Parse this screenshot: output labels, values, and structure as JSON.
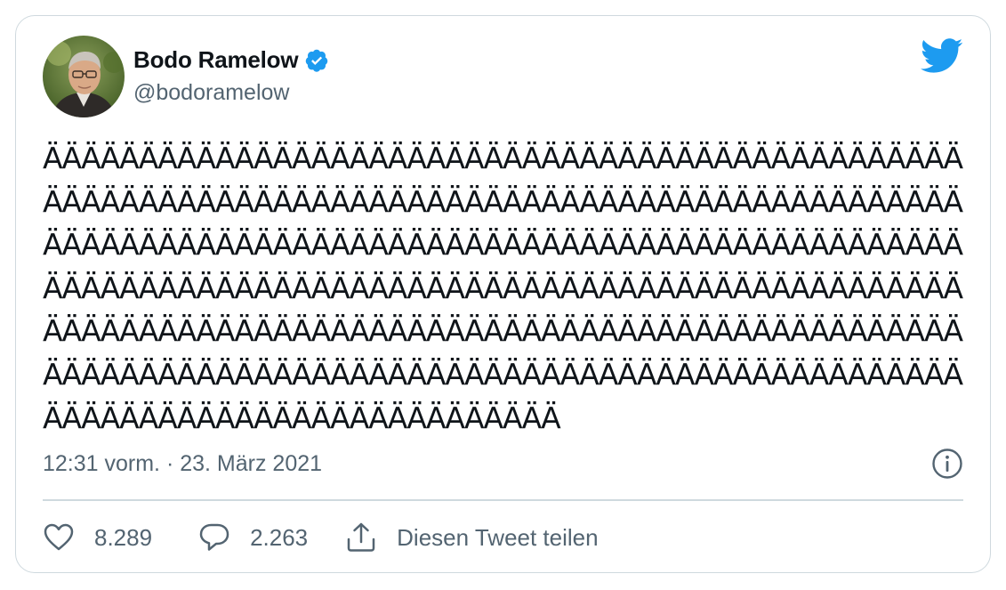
{
  "author": {
    "display_name": "Bodo Ramelow",
    "handle": "@bodoramelow",
    "verified": true,
    "avatar_icon": "profile-photo"
  },
  "tweet": {
    "text": "ÄÄÄÄÄÄÄÄÄÄÄÄÄÄÄÄÄÄÄÄÄÄÄÄÄÄÄÄÄÄÄÄÄÄÄÄÄÄÄÄÄÄÄÄÄÄÄÄÄÄÄÄÄÄÄÄÄÄÄÄÄÄÄÄÄÄÄÄÄÄÄÄÄÄÄÄÄÄÄÄÄÄÄÄÄÄÄÄÄÄÄÄÄÄÄÄÄÄÄÄÄÄÄÄÄÄÄÄÄÄÄÄÄÄÄÄÄÄÄÄÄÄÄÄÄÄÄÄÄÄÄÄÄÄÄÄÄÄÄÄÄÄÄÄÄÄÄÄÄÄÄÄÄÄÄÄÄÄÄÄÄÄÄÄÄÄÄÄÄÄÄÄÄÄÄÄÄÄÄÄÄÄÄÄÄÄÄÄÄÄÄÄÄÄÄÄÄÄÄÄÄÄÄÄÄÄÄÄÄÄÄÄÄÄÄÄÄÄÄÄÄÄÄÄÄÄÄÄÄÄÄÄÄÄÄÄÄÄÄÄÄÄÄÄÄÄÄÄÄÄÄÄÄÄÄÄÄÄÄÄÄÄÄÄÄÄÄÄÄÄÄÄÄÄÄÄÄÄÄÄÄÄÄÄÄÄÄÄÄÄÄÄÄÄÄÄÄÄÄÄÄÄÄÄÄÄÄÄÄÄÄÄÄÄÄ",
    "timestamp": "12:31 vorm. · 23. März 2021"
  },
  "actions": {
    "likes": "8.289",
    "replies": "2.263",
    "share_label": "Diesen Tweet teilen"
  },
  "colors": {
    "brand_blue": "#1d9bf0",
    "text_primary": "#0f1419",
    "text_secondary": "#536471",
    "border": "#cfd9de"
  },
  "icons": {
    "verified": "verified-badge-icon",
    "logo": "twitter-bird-icon",
    "info": "info-icon",
    "like": "heart-icon",
    "reply": "speech-bubble-icon",
    "share": "share-upload-icon"
  }
}
